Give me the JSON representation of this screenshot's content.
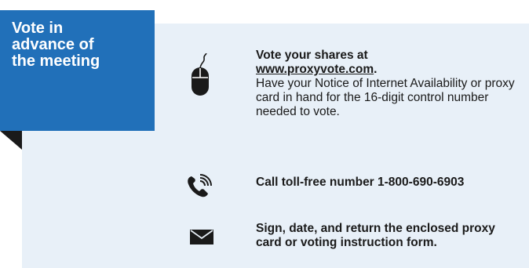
{
  "banner": {
    "title": "Vote in\nadvance of\nthe meeting"
  },
  "options": [
    {
      "icon": "computer-mouse-icon",
      "heading": "Vote your shares at",
      "link_text": "www.proxyvote.com",
      "link_suffix": ".",
      "body": "Have your Notice of Internet Availability or proxy card in hand for the 16-digit control number needed to vote."
    },
    {
      "icon": "telephone-icon",
      "text": "Call toll-free number 1-800-690-6903"
    },
    {
      "icon": "envelope-icon",
      "text": "Sign, date, and return the enclosed proxy card or voting instruction form."
    }
  ],
  "colors": {
    "banner": "#2170b9",
    "panel": "#e8f0f8",
    "text": "#1a1a1a"
  }
}
